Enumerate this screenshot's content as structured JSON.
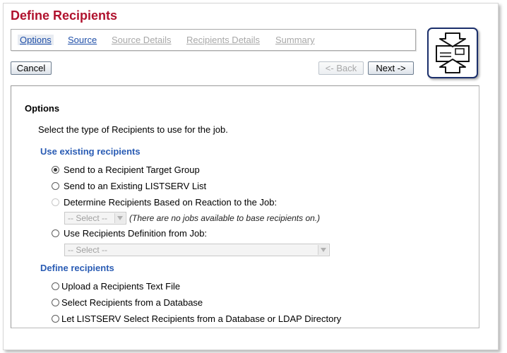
{
  "page_title": "Define Recipients",
  "steps": [
    {
      "label": "Options",
      "state": "active"
    },
    {
      "label": "Source",
      "state": "enabled"
    },
    {
      "label": "Source Details",
      "state": "disabled"
    },
    {
      "label": "Recipients Details",
      "state": "disabled"
    },
    {
      "label": "Summary",
      "state": "disabled"
    }
  ],
  "buttons": {
    "cancel": "Cancel",
    "back": "<- Back",
    "next": "Next ->"
  },
  "panel": {
    "heading": "Options",
    "intro": "Select the type of Recipients to use for the job.",
    "existing_section": "Use existing recipients",
    "existing_options": [
      {
        "label": "Send to a Recipient Target Group",
        "checked": true,
        "enabled": true
      },
      {
        "label": "Send to an Existing LISTSERV List",
        "checked": false,
        "enabled": true
      },
      {
        "label": "Determine Recipients Based on Reaction to the Job:",
        "checked": false,
        "enabled": false
      },
      {
        "label": "Use Recipients Definition from Job:",
        "checked": false,
        "enabled": true
      }
    ],
    "reaction_select": {
      "value": "-- Select --",
      "note": "(There are no jobs available to base recipients on.)"
    },
    "job_select": {
      "value": "-- Select --"
    },
    "define_section": "Define recipients",
    "define_options": [
      {
        "label": "Upload a Recipients Text File",
        "checked": false
      },
      {
        "label": "Select Recipients from a Database",
        "checked": false
      },
      {
        "label": "Let LISTSERV Select Recipients from a Database or LDAP Directory",
        "checked": false
      }
    ]
  },
  "colors": {
    "title": "#b0122e",
    "link": "#1f4fa8",
    "section": "#2a5cb4",
    "disabled": "#a8a8a8",
    "icon_border": "#1b2f6b"
  },
  "icons": {
    "wizard": "recipients-envelope-icon",
    "dropdown": "chevron-down-icon"
  }
}
